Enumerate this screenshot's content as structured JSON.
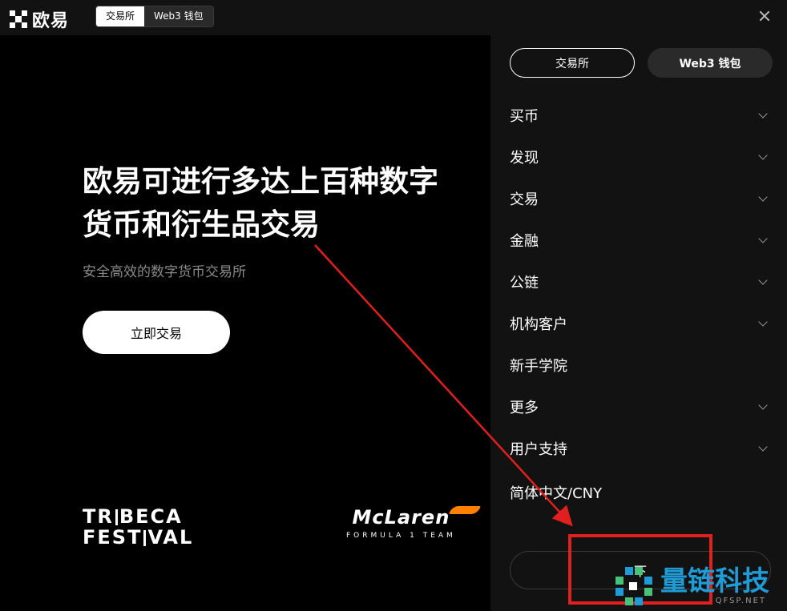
{
  "header": {
    "logo_text": "欧易",
    "switch": [
      "交易所",
      "Web3 钱包"
    ]
  },
  "hero": {
    "title": "欧易可进行多达上百种数字货币和衍生品交易",
    "subtitle": "安全高效的数字货币交易所",
    "cta_label": "立即交易"
  },
  "partners": {
    "tribeca_line1_a": "TR",
    "tribeca_line1_b": "BECA",
    "tribeca_line2_a": "FEST",
    "tribeca_line2_b": "VAL",
    "mclaren_name": "McLaren",
    "mclaren_sub": "FORMULA 1 TEAM"
  },
  "panel": {
    "tabs": [
      "交易所",
      "Web3 钱包"
    ],
    "menu": [
      {
        "label": "买币",
        "chevron": true
      },
      {
        "label": "发现",
        "chevron": true
      },
      {
        "label": "交易",
        "chevron": true
      },
      {
        "label": "金融",
        "chevron": true
      },
      {
        "label": "公链",
        "chevron": true
      },
      {
        "label": "机构客户",
        "chevron": true
      },
      {
        "label": "新手学院",
        "chevron": false
      },
      {
        "label": "更多",
        "chevron": true
      },
      {
        "label": "用户支持",
        "chevron": true
      }
    ],
    "language": "简体中文/CNY",
    "download_label": "下"
  },
  "watermark": {
    "cn": "量链科技",
    "en": "QFSP.NET"
  },
  "colors": {
    "panel_bg": "#121212",
    "annotation_red": "#e0201e",
    "watermark_blue": "#1f9bd6",
    "mclaren_orange": "#ff8000"
  }
}
